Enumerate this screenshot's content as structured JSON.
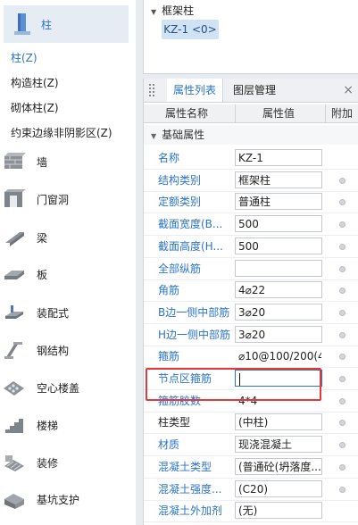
{
  "nav": {
    "active_category": {
      "label": "柱",
      "icon": "column-icon"
    },
    "subitems": [
      {
        "label": "柱(Z)",
        "selected": true
      },
      {
        "label": "构造柱(Z)",
        "selected": false
      },
      {
        "label": "砌体柱(Z)",
        "selected": false
      },
      {
        "label": "约束边缘非阴影区(Z)",
        "selected": false
      }
    ],
    "categories": [
      {
        "label": "墙",
        "icon": "wall-icon"
      },
      {
        "label": "门窗洞",
        "icon": "door-window-icon"
      },
      {
        "label": "梁",
        "icon": "beam-icon"
      },
      {
        "label": "板",
        "icon": "slab-icon"
      },
      {
        "label": "装配式",
        "icon": "prefab-icon"
      },
      {
        "label": "钢结构",
        "icon": "steel-structure-icon"
      },
      {
        "label": "空心楼盖",
        "icon": "hollow-floor-icon"
      },
      {
        "label": "楼梯",
        "icon": "stair-icon"
      },
      {
        "label": "装修",
        "icon": "decoration-icon"
      },
      {
        "label": "基坑支护",
        "icon": "foundation-pit-icon"
      }
    ]
  },
  "tree": {
    "root": "框架柱",
    "node": "KZ-1 <0>"
  },
  "panel": {
    "tabs": [
      "属性列表",
      "图层管理"
    ],
    "close_glyph": "×",
    "columns": [
      "属性名称",
      "属性值",
      "附加"
    ],
    "group": "基础属性",
    "rows": [
      {
        "name": "名称",
        "value": "KZ-1",
        "color": "blue",
        "dot": false
      },
      {
        "name": "结构类别",
        "value": "框架柱",
        "color": "blue",
        "dot": true
      },
      {
        "name": "定额类别",
        "value": "普通柱",
        "color": "blue",
        "dot": true
      },
      {
        "name": "截面宽度(B...",
        "value": "500",
        "color": "blue",
        "dot": true
      },
      {
        "name": "截面高度(H...",
        "value": "500",
        "color": "blue",
        "dot": true
      },
      {
        "name": "全部纵筋",
        "value": "",
        "color": "blue",
        "dot": true
      },
      {
        "name": "角筋",
        "value": "4⌀22",
        "color": "blue",
        "dot": true
      },
      {
        "name": "B边一侧中部筋",
        "value": "3⌀20",
        "color": "blue",
        "dot": true
      },
      {
        "name": "H边一侧中部筋",
        "value": "3⌀20",
        "color": "blue",
        "dot": true
      },
      {
        "name": "箍筋",
        "value": "⌀10@100/200(4",
        "color": "blue",
        "dot": true,
        "plain": true
      },
      {
        "name": "节点区箍筋",
        "value": "",
        "color": "blue",
        "dot": true,
        "editing": true
      },
      {
        "name": "箍筋胶数",
        "value": "4*4",
        "color": "blue",
        "dot": true,
        "plain": true
      },
      {
        "name": "柱类型",
        "value": "(中柱)",
        "color": "dark",
        "dot": true
      },
      {
        "name": "材质",
        "value": "现浇混凝土",
        "color": "blue",
        "dot": true
      },
      {
        "name": "混凝土类型",
        "value": "(普通砼(坍落度...",
        "color": "blue",
        "dot": true
      },
      {
        "name": "混凝土强度...",
        "value": "(C20)",
        "color": "blue",
        "dot": true
      },
      {
        "name": "混凝土外加剂",
        "value": "(无)",
        "color": "blue",
        "dot": false
      }
    ]
  },
  "colors": {
    "accent": "#2b74c7",
    "highlight": "#e03a3a",
    "node_bg": "#cfe3f5"
  }
}
